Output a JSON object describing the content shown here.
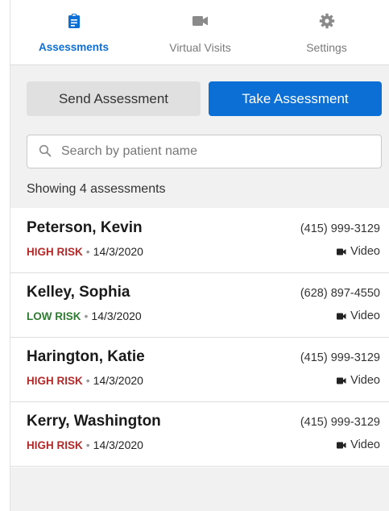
{
  "tabs": [
    {
      "label": "Assessments",
      "icon": "clipboard-icon",
      "active": true
    },
    {
      "label": "Virtual Visits",
      "icon": "video-camera-icon",
      "active": false
    },
    {
      "label": "Settings",
      "icon": "gear-icon",
      "active": false
    }
  ],
  "actions": {
    "send_label": "Send Assessment",
    "take_label": "Take Assessment"
  },
  "search": {
    "placeholder": "Search by patient name",
    "value": ""
  },
  "summary": "Showing 4 assessments",
  "assessments": [
    {
      "name": "Peterson, Kevin",
      "risk": "HIGH RISK",
      "date": "14/3/2020",
      "phone": "(415) 999-3129",
      "visit_type": "Video"
    },
    {
      "name": "Kelley, Sophia",
      "risk": "LOW RISK",
      "date": "14/3/2020",
      "phone": "(628) 897-4550",
      "visit_type": "Video"
    },
    {
      "name": "Harington, Katie",
      "risk": "HIGH RISK",
      "date": "14/3/2020",
      "phone": "(415) 999-3129",
      "visit_type": "Video"
    },
    {
      "name": "Kerry, Washington",
      "risk": "HIGH RISK",
      "date": "14/3/2020",
      "phone": "(415) 999-3129",
      "visit_type": "Video"
    }
  ],
  "colors": {
    "accent": "#0b6fd6",
    "high_risk": "#b22a2a",
    "low_risk": "#2e7d32",
    "background": "#f1f1f1"
  }
}
